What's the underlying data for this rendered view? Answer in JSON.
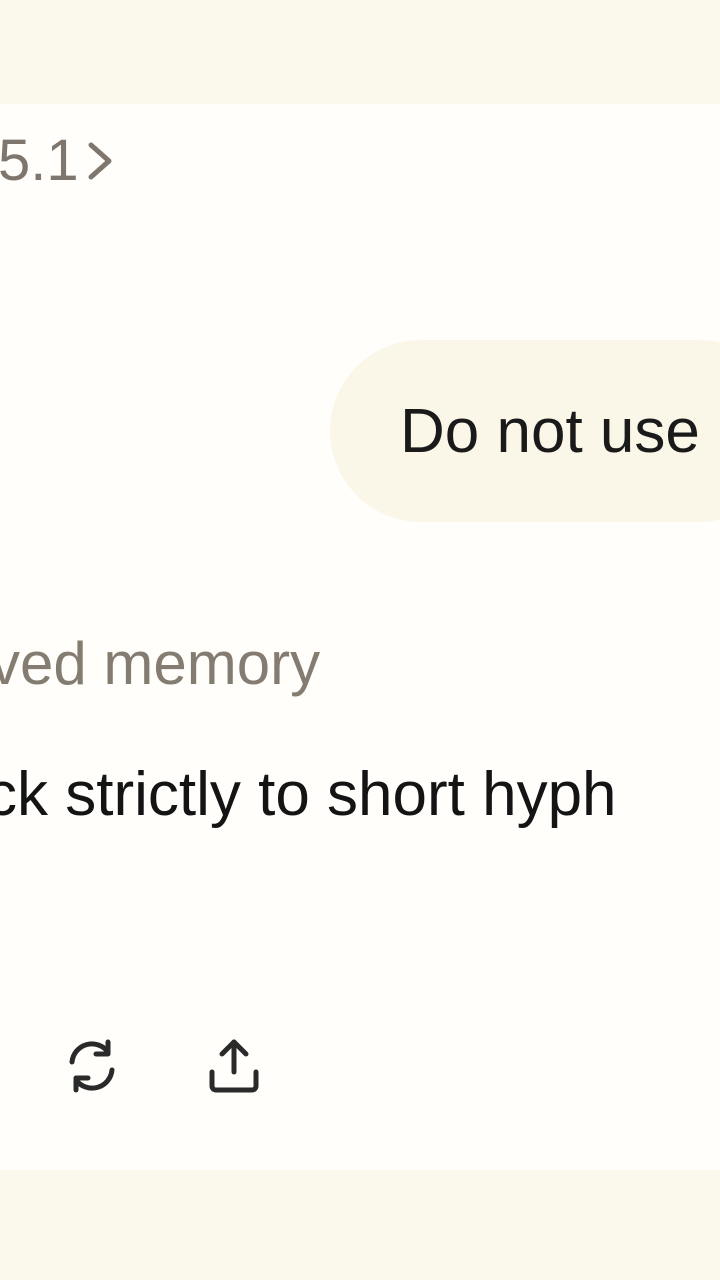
{
  "header": {
    "model_label": "5.1",
    "chevron_icon": "chevron-right-icon"
  },
  "conversation": {
    "user_message": "Do not use",
    "memory_label": "ved memory",
    "assistant_message": "ck strictly to short hyph"
  },
  "actions": [
    {
      "name": "regenerate",
      "icon": "refresh-icon"
    },
    {
      "name": "share",
      "icon": "share-icon"
    }
  ],
  "colors": {
    "bar_background": "#fbf8ec",
    "page_background": "#fffefb",
    "bubble_background": "#faf6e8",
    "muted_text": "#857c71",
    "primary_text": "#141414"
  }
}
